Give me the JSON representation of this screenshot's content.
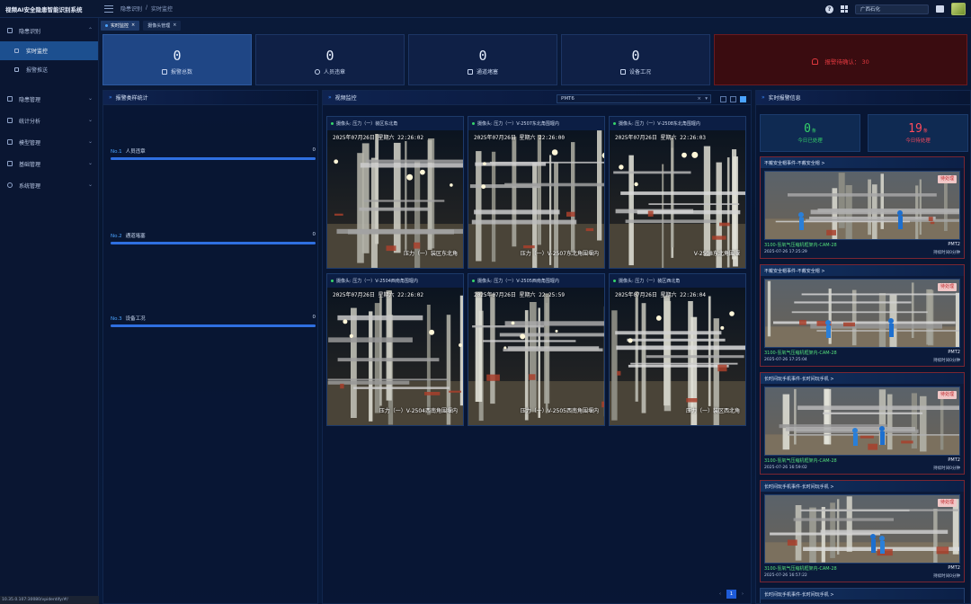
{
  "app": {
    "title": "视频AI安全隐患智能识别系统"
  },
  "breadcrumb": [
    "隐患识别",
    "/",
    "实时监控"
  ],
  "topbar": {
    "org": "广西石化"
  },
  "sidebar": {
    "items": [
      {
        "label": "隐患识别",
        "children": [
          "实时监控",
          "报警推送"
        ]
      },
      {
        "label": "隐患管理"
      },
      {
        "label": "统计分析"
      },
      {
        "label": "模型管理"
      },
      {
        "label": "基础管理"
      },
      {
        "label": "系统管理"
      }
    ]
  },
  "tabs": [
    {
      "label": "实时监控",
      "close": "×"
    },
    {
      "label": "摄像头管理",
      "close": "×"
    }
  ],
  "stats": [
    {
      "value": "0",
      "label": "报警总数"
    },
    {
      "value": "0",
      "label": "人员违章"
    },
    {
      "value": "0",
      "label": "通道堵塞"
    },
    {
      "value": "0",
      "label": "设备工况"
    }
  ],
  "alarm_total": {
    "label": "报警待确认：",
    "value": "30"
  },
  "left_panel": {
    "title": "报警类样统计",
    "categories": [
      {
        "no": "No.1",
        "label": "人员违章",
        "value": "0",
        "fill": 1.0
      },
      {
        "no": "No.2",
        "label": "通道堵塞",
        "value": "0",
        "fill": 1.0
      },
      {
        "no": "No.3",
        "label": "设备工况",
        "value": "0",
        "fill": 1.0
      }
    ]
  },
  "video_panel": {
    "title": "视频监控",
    "selected": "PMT6",
    "clear": "×",
    "dropdown": "▾",
    "cameras": [
      {
        "title": "摄像头:  压力（一）装区东北角",
        "time": "2025年07月26日  星期六  22:26:02",
        "caption": "压力（一）装区东北角"
      },
      {
        "title": "摄像头:  压力（一）V-2507东北角围堰内",
        "time": "2025年07月26日  星期六  22:26:00",
        "caption": "压力（一）V-2507东北角围堰内"
      },
      {
        "title": "摄像头:  压力（一）V-2508东北角围堰内",
        "time": "2025年07月26日  星期六  22:26:03",
        "caption": "V-2508东北角围堰"
      },
      {
        "title": "摄像头:  压力（一）V-2504西南角围堰内",
        "time": "2025年07月26日  星期六  22:26:02",
        "caption": "压力（一）V-2504西南角围堰内"
      },
      {
        "title": "摄像头:  压力（一）V-2505西南角围堰内",
        "time": "2025年07月26日  星期六  22:25:59",
        "caption": "压力（一）V-2505西南角围堰内"
      },
      {
        "title": "摄像头:  压力（一）装区西北角",
        "time": "2025年07月26日  星期六  22:26:04",
        "caption": "压力（一）装区西北角"
      }
    ],
    "pager": {
      "prev": "‹",
      "page": "1",
      "next": "›"
    }
  },
  "right_panel": {
    "title": "实时报警信息",
    "today_handled": {
      "value": "0",
      "unit": "条",
      "label": "今日已处理"
    },
    "today_pending": {
      "value": "19",
      "unit": "条",
      "label": "今日待处理"
    },
    "alarms": [
      {
        "title": "不戴安全帽事件-不戴安全帽 >",
        "badge": "待处理",
        "camera": "3100-氢氧气压缩机框架内-CAM-28",
        "model": "PMT2",
        "time": "2025-07-26 17:25:29",
        "status": "持续时间0分钟"
      },
      {
        "title": "不戴安全帽事件-不戴安全帽 >",
        "badge": "待处理",
        "camera": "3100-氢氧气压缩机框架内-CAM-28",
        "model": "PMT2",
        "time": "2025-07-26 17:25:04",
        "status": "持续时间0分钟"
      },
      {
        "title": "长时间玩手机事件-长时间玩手机 >",
        "badge": "待处理",
        "camera": "3100-氢氧气压缩机框架内-CAM-28",
        "model": "PMT2",
        "time": "2025-07-26 16:59:02",
        "status": "持续时间0分钟"
      },
      {
        "title": "长时间玩手机事件-长时间玩手机 >",
        "badge": "待处理",
        "camera": "3100-氢氧气压缩机框架内-CAM-28",
        "model": "PMT2",
        "time": "2025-07-26 16:57:22",
        "status": "持续时间0分钟"
      },
      {
        "title": "长时间玩手机事件-长时间玩手机 >"
      }
    ]
  },
  "statusbar": {
    "url": "10.35.0.107:30080/vpidentify/#/"
  },
  "colors": {
    "accent": "#1e5bd8",
    "alarm": "#e0383e",
    "handled": "#36d46a",
    "pending": "#ff4b5c"
  }
}
